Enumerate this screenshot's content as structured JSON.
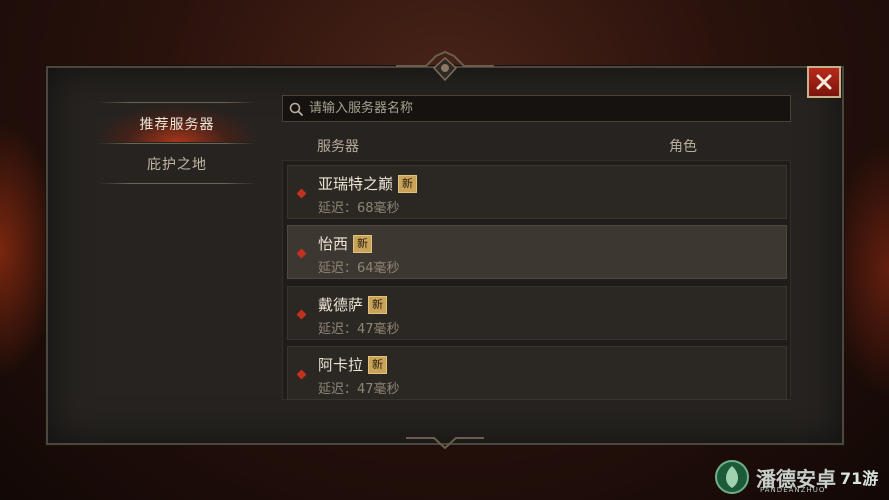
{
  "sidebar": {
    "items": [
      {
        "label": "推荐服务器",
        "active": true
      },
      {
        "label": "庇护之地",
        "active": false
      }
    ]
  },
  "search": {
    "placeholder": "请输入服务器名称",
    "value": ""
  },
  "table": {
    "headers": {
      "server": "服务器",
      "role": "角色"
    },
    "rows": [
      {
        "name": "亚瑞特之巅",
        "badge": "新",
        "latency": "延迟：68毫秒"
      },
      {
        "name": "怡西",
        "badge": "新",
        "latency": "延迟：64毫秒",
        "selected": true
      },
      {
        "name": "戴德萨",
        "badge": "新",
        "latency": "延迟：47毫秒"
      },
      {
        "name": "阿卡拉",
        "badge": "新",
        "latency": "延迟：47毫秒"
      }
    ]
  },
  "icons": {
    "search": "search-icon",
    "close": "close-icon",
    "row_marker": "diamond-icon"
  },
  "colors": {
    "accent": "#c0321e",
    "badge": "#c9a35a",
    "panel": "#262320"
  },
  "watermark": {
    "text": "潘德安卓",
    "sub": "PANDEANZHUO",
    "brand": "71游"
  }
}
